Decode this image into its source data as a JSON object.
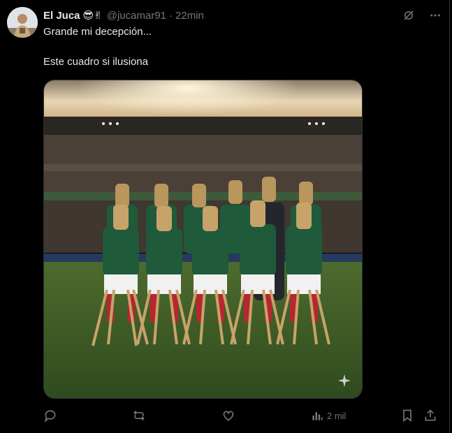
{
  "tweet": {
    "display_name": "El Juca",
    "emojis": "😎✌",
    "handle": "@jucamar91",
    "separator": "·",
    "time": "22min",
    "line1": "Grande mi decepción...",
    "line2": "Este cuadro si ilusiona"
  },
  "actions": {
    "views": "2 mil"
  },
  "icons": {
    "grok": "grok-icon",
    "more": "more-icon",
    "reply": "reply-icon",
    "retweet": "retweet-icon",
    "like": "like-icon",
    "views": "views-icon",
    "bookmark": "bookmark-icon",
    "share": "share-icon",
    "sparkle": "sparkle-icon"
  },
  "colors": {
    "background": "#000000",
    "text": "#e7e9ea",
    "muted": "#71767b",
    "jersey": "#1f5a3a"
  }
}
